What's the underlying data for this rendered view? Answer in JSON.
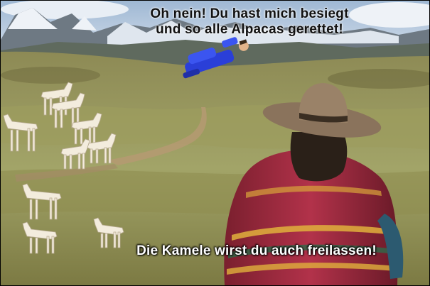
{
  "message": {
    "line1": "Oh nein! Du hast mich besiegt",
    "line2": "und so alle Alpacas gerettet!"
  },
  "footer_message": "Die Kamele wirst du auch freilassen!",
  "colors": {
    "sky": "#b9cde0",
    "snow": "#eef2f7",
    "mountain": "#6f7a84",
    "grass_light": "#a7a86a",
    "grass_dark": "#6e6a3c",
    "poncho_red": "#a8283a",
    "hat": "#8a735c",
    "villain_blue": "#2a3fd8"
  },
  "sprites": {
    "alpacas": "alpaca-sprite",
    "villain": "flying-defeated-villain",
    "hero": "herder-with-hat-and-poncho"
  }
}
